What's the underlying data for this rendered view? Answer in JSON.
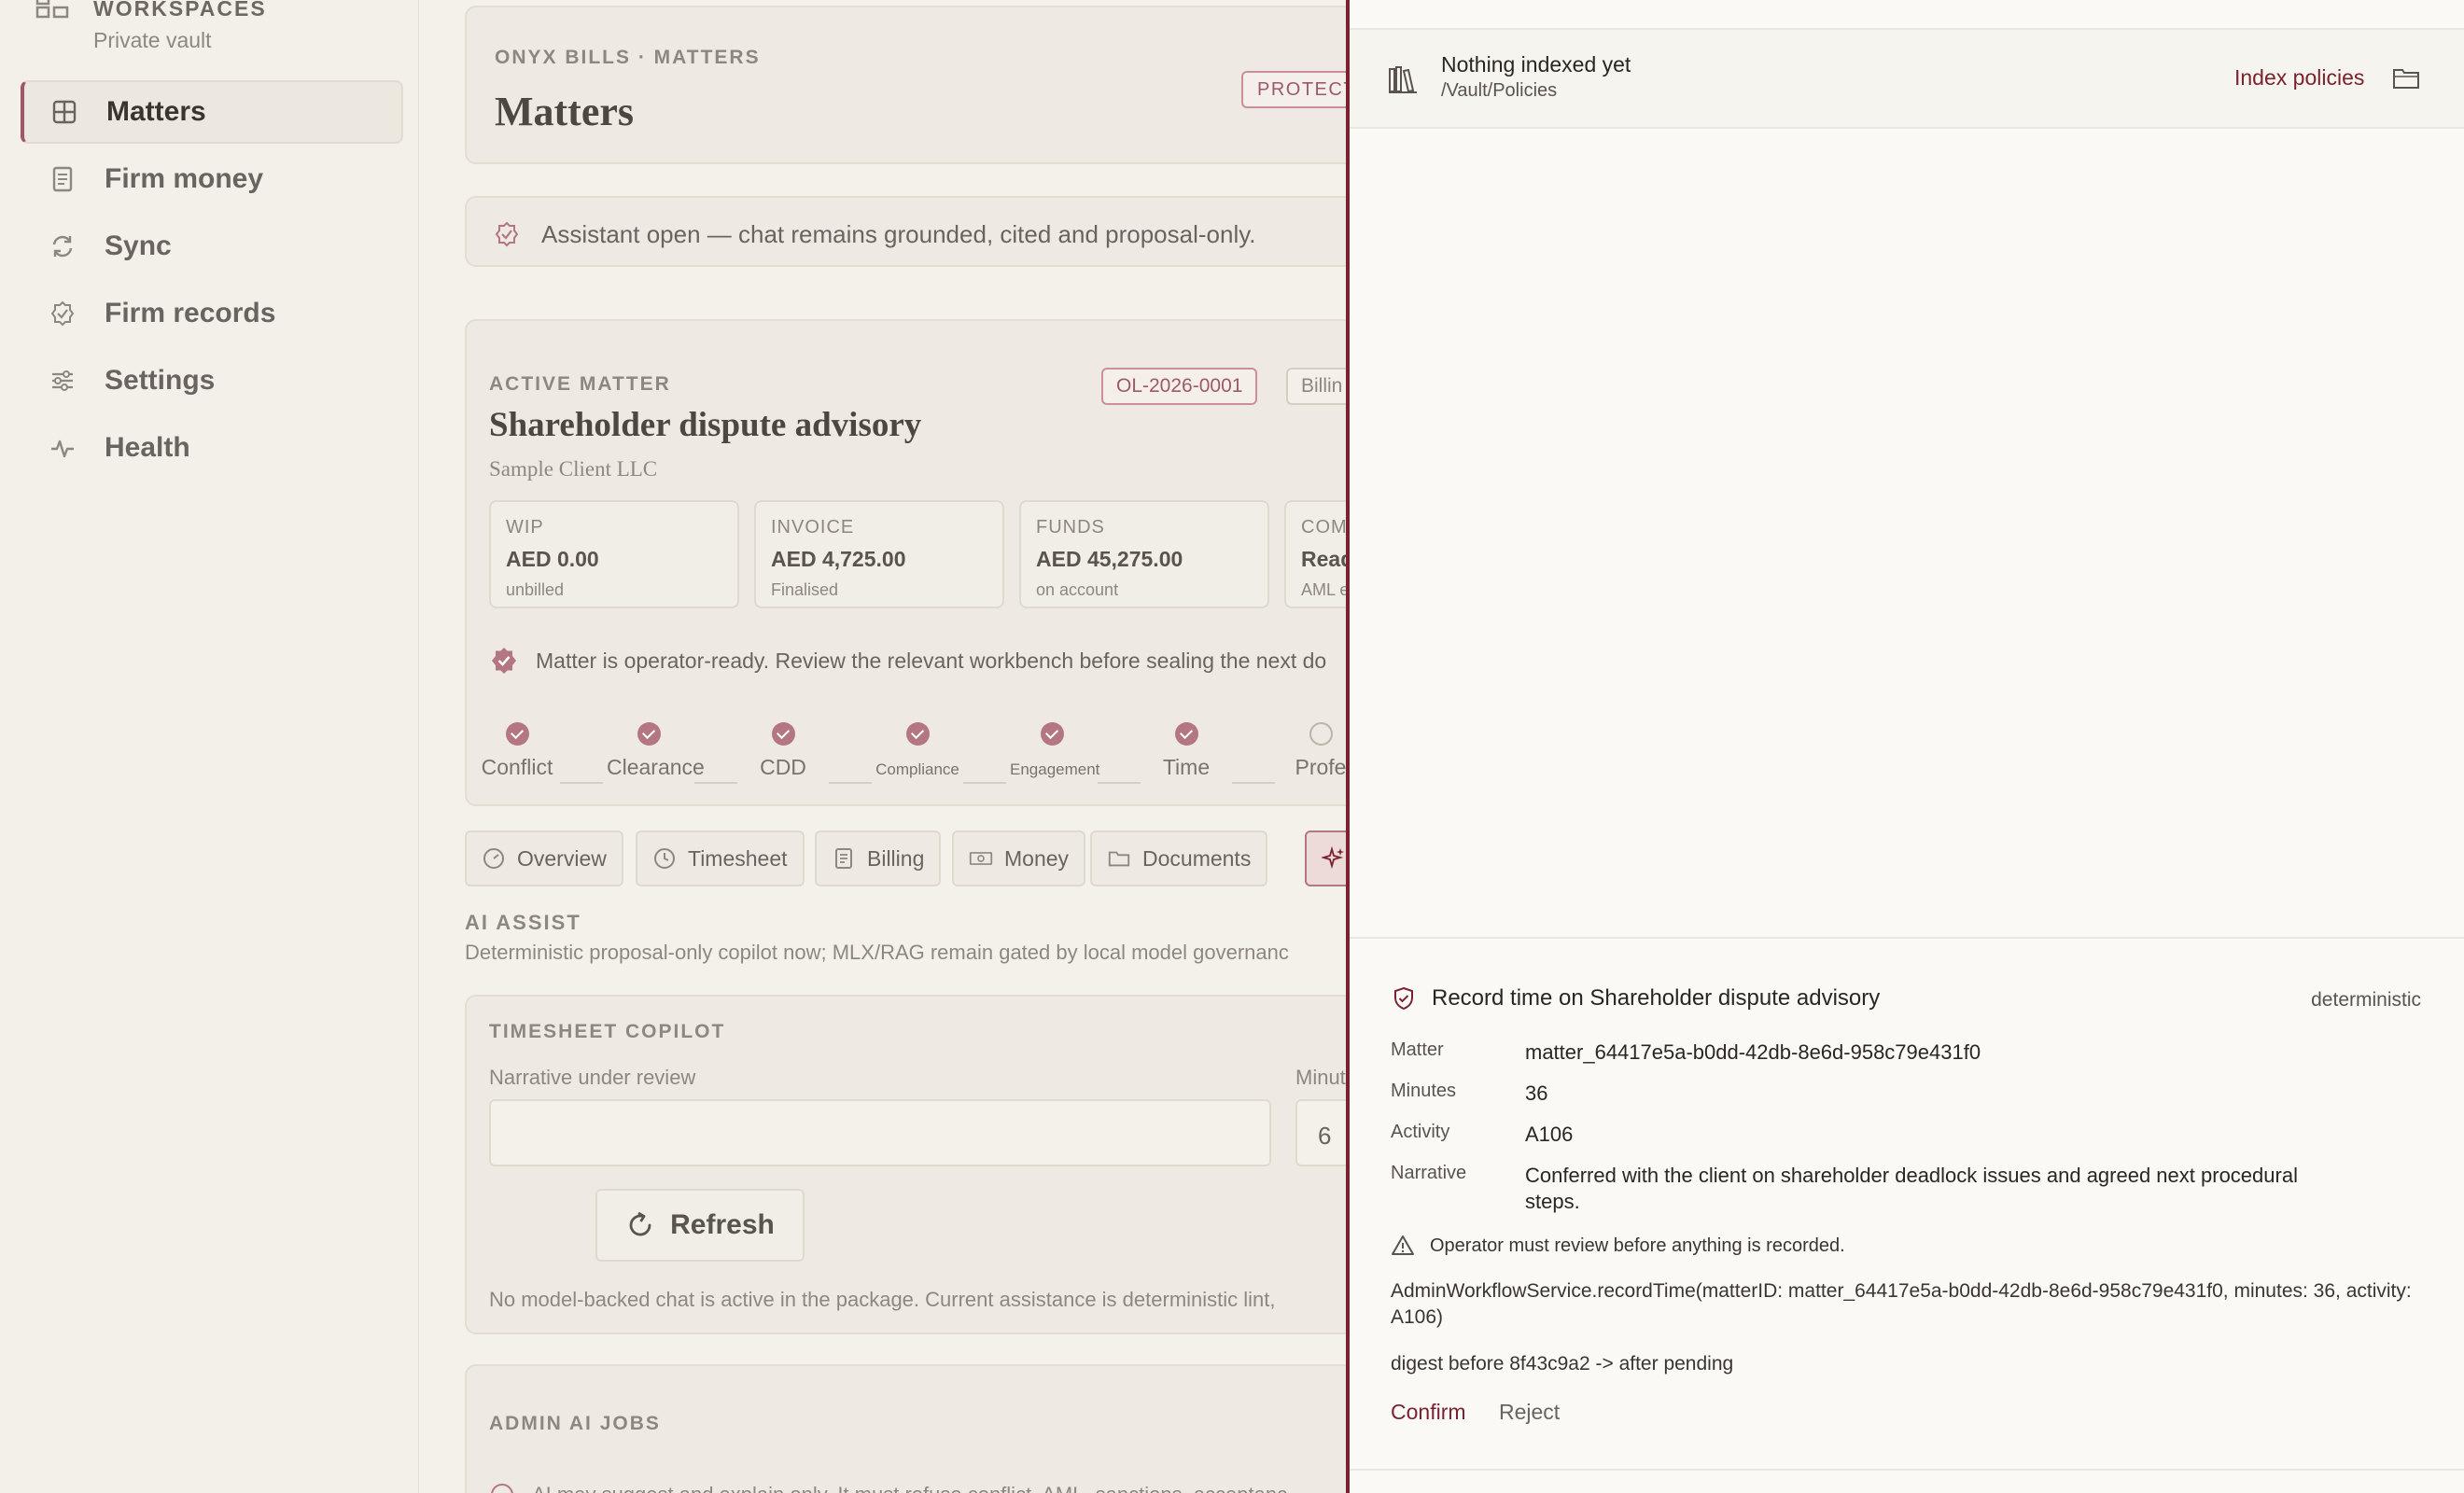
{
  "sidebar": {
    "workspace_title": "WORKSPACES",
    "workspace_subtitle": "Private vault",
    "items": [
      {
        "label": "Matters",
        "icon": "grid-icon",
        "active": true
      },
      {
        "label": "Firm money",
        "icon": "ledger-icon"
      },
      {
        "label": "Sync",
        "icon": "sync-icon"
      },
      {
        "label": "Firm records",
        "icon": "badge-check-icon"
      },
      {
        "label": "Settings",
        "icon": "sliders-icon"
      },
      {
        "label": "Health",
        "icon": "pulse-icon"
      }
    ]
  },
  "header": {
    "eyebrow": "ONYX BILLS · MATTERS",
    "title": "Matters",
    "badge": "PROTECTED"
  },
  "assistant_bar": {
    "text": "Assistant open — chat remains grounded, cited and proposal-only."
  },
  "matter": {
    "eyebrow": "ACTIVE MATTER",
    "title": "Shareholder dispute advisory",
    "client": "Sample Client LLC",
    "id_tag": "OL-2026-0001",
    "billing_tag": "Billin",
    "stats": [
      {
        "label": "WIP",
        "value": "AED 0.00",
        "sub": "unbilled"
      },
      {
        "label": "INVOICE",
        "value": "AED 4,725.00",
        "sub": "Finalised"
      },
      {
        "label": "FUNDS",
        "value": "AED 45,275.00",
        "sub": "on account"
      },
      {
        "label": "COM",
        "value": "Read",
        "sub": "AML e"
      }
    ],
    "ready_text": "Matter is operator-ready. Review the relevant workbench before sealing the next do",
    "steps": [
      {
        "label": "Conflict",
        "done": true
      },
      {
        "label": "Clearance",
        "done": true
      },
      {
        "label": "CDD",
        "done": true
      },
      {
        "label": "Compliance",
        "done": true
      },
      {
        "label": "Engagement",
        "done": true
      },
      {
        "label": "Time",
        "done": true
      },
      {
        "label": "Profe",
        "done": false
      }
    ]
  },
  "tabs": [
    {
      "label": "Overview",
      "icon": "gauge-icon"
    },
    {
      "label": "Timesheet",
      "icon": "clock-icon"
    },
    {
      "label": "Billing",
      "icon": "document-icon"
    },
    {
      "label": "Money",
      "icon": "banknote-icon"
    },
    {
      "label": "Documents",
      "icon": "folder-icon"
    },
    {
      "label": "",
      "icon": "sparkle-icon",
      "active": true
    }
  ],
  "ai_assist": {
    "label": "AI ASSIST",
    "description": "Deterministic proposal-only copilot now; MLX/RAG remain gated by local model governanc"
  },
  "timesheet_copilot": {
    "title": "TIMESHEET COPILOT",
    "narrative_label": "Narrative under review",
    "narrative_value": "",
    "minutes_label": "Minut",
    "minutes_value": "6",
    "refresh_label": "Refresh",
    "note": "No model-backed chat is active in the package. Current assistance is deterministic lint,"
  },
  "admin_jobs": {
    "title": "ADMIN AI JOBS",
    "text": "AI may suggest and explain only. It must refuse conflict, AML, sanctions, acceptanc"
  },
  "drawer": {
    "index": {
      "title": "Nothing indexed yet",
      "path": "/Vault/Policies",
      "action": "Index policies"
    },
    "proposal": {
      "title": "Record time on Shareholder dispute advisory",
      "mode": "deterministic",
      "fields": [
        {
          "key": "Matter",
          "value": "matter_64417e5a-b0dd-42db-8e6d-958c79e431f0"
        },
        {
          "key": "Minutes",
          "value": "36"
        },
        {
          "key": "Activity",
          "value": "A106"
        },
        {
          "key": "Narrative",
          "value": "Conferred with the client on shareholder deadlock issues and agreed next procedural steps."
        }
      ],
      "warning": "Operator must review before anything is recorded.",
      "call": "AdminWorkflowService.recordTime(matterID: matter_64417e5a-b0dd-42db-8e6d-958c79e431f0, minutes: 36, activity: A106)",
      "digest": "digest before 8f43c9a2 -> after pending",
      "confirm_label": "Confirm",
      "reject_label": "Reject"
    }
  },
  "colors": {
    "accent": "#7a2330",
    "accent_soft": "#b47680",
    "background": "#f4f1eb",
    "drawer_background": "#faf9f5"
  }
}
